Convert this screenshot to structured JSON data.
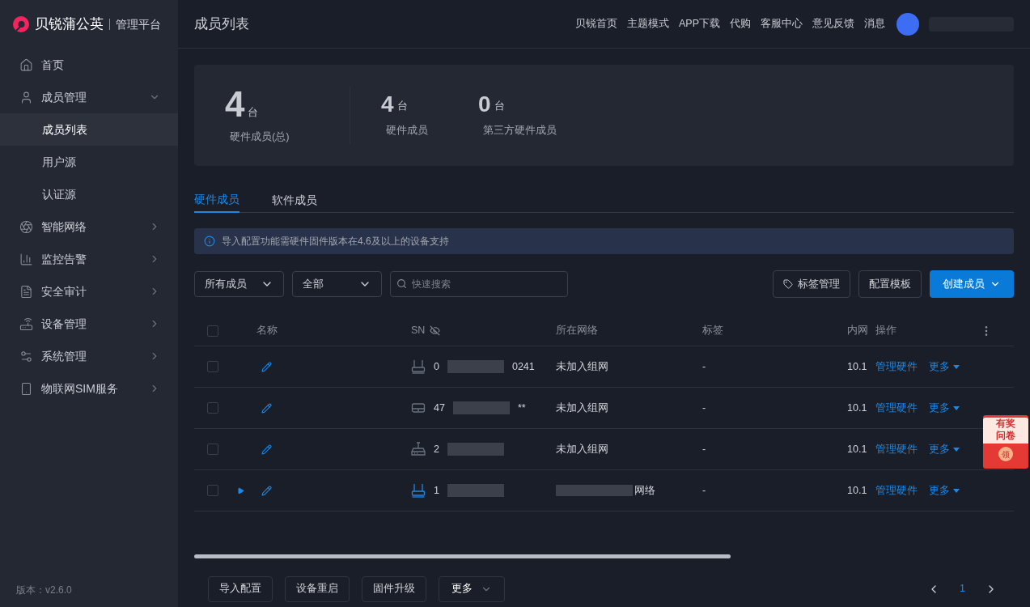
{
  "brand": {
    "name": "贝锐蒲公英",
    "suffix": "管理平台"
  },
  "sidebar": {
    "items": [
      {
        "label": "首页",
        "expanded": false,
        "selected": false
      },
      {
        "label": "成员管理",
        "expanded": true,
        "selected": false,
        "children": [
          {
            "label": "成员列表",
            "selected": true
          },
          {
            "label": "用户源",
            "selected": false
          },
          {
            "label": "认证源",
            "selected": false
          }
        ]
      },
      {
        "label": "智能网络",
        "expanded": false,
        "selected": false
      },
      {
        "label": "监控告警",
        "expanded": false,
        "selected": false
      },
      {
        "label": "安全审计",
        "expanded": false,
        "selected": false
      },
      {
        "label": "设备管理",
        "expanded": false,
        "selected": false
      },
      {
        "label": "系统管理",
        "expanded": false,
        "selected": false
      },
      {
        "label": "物联网SIM服务",
        "expanded": false,
        "selected": false
      }
    ],
    "version": "版本：v2.6.0"
  },
  "header": {
    "title": "成员列表",
    "links": [
      "贝锐首页",
      "主题模式",
      "APP下载",
      "代购",
      "客服中心",
      "意见反馈",
      "消息"
    ]
  },
  "stats": [
    {
      "value": "4",
      "unit": "台",
      "label": "硬件成员(总)"
    },
    {
      "value": "4",
      "unit": "台",
      "label": "硬件成员"
    },
    {
      "value": "0",
      "unit": "台",
      "label": "第三方硬件成员"
    }
  ],
  "tabs": [
    {
      "label": "硬件成员",
      "selected": true
    },
    {
      "label": "软件成员",
      "selected": false
    }
  ],
  "notice": "导入配置功能需硬件固件版本在4.6及以上的设备支持",
  "filters": {
    "selects": [
      "所有成员",
      "全部"
    ],
    "search": {
      "placeholder": "快速搜索"
    }
  },
  "actions": [
    {
      "label": "标签管理",
      "kind": "tag"
    },
    {
      "label": "配置模板",
      "kind": "plain"
    },
    {
      "label": "创建成员",
      "kind": "primary"
    }
  ],
  "table": {
    "header_checked": false,
    "columns": [
      "名称",
      "SN",
      "所在网络",
      "标签",
      "内网",
      "操作"
    ],
    "rows": [
      {
        "kind": "router",
        "expandable": false,
        "highlighted": false,
        "checked": false,
        "sn_head": "0",
        "sn_tail": "0241",
        "network": "未加入组网",
        "network_redacted": false,
        "tag": "-",
        "ip": "10.1",
        "manage": "管理硬件",
        "more": "更多"
      },
      {
        "kind": "box",
        "expandable": false,
        "highlighted": false,
        "checked": false,
        "sn_head": "47",
        "sn_tail": "**",
        "network": "未加入组网",
        "network_redacted": false,
        "tag": "-",
        "ip": "10.1",
        "manage": "管理硬件",
        "more": "更多"
      },
      {
        "kind": "gateway",
        "expandable": false,
        "highlighted": false,
        "checked": false,
        "sn_head": "2",
        "network": "未加入组网",
        "network_redacted": false,
        "tag": "-",
        "ip": "10.1",
        "manage": "管理硬件",
        "more": "更多"
      },
      {
        "kind": "router",
        "expandable": true,
        "highlighted": true,
        "checked": false,
        "sn_head": "1",
        "network": "网络",
        "network_redacted": true,
        "tag": "-",
        "ip": "10.1",
        "manage": "管理硬件",
        "more": "更多"
      }
    ]
  },
  "bulk_buttons": [
    {
      "label": "导入配置",
      "kind": "plain"
    },
    {
      "label": "设备重启",
      "kind": "plain"
    },
    {
      "label": "固件升级",
      "kind": "plain"
    },
    {
      "label": "更多",
      "kind": "dropdown"
    }
  ],
  "pagination": {
    "pages": [
      {
        "label": "1",
        "selected": true
      }
    ]
  },
  "promo": {
    "lines": [
      "有奖",
      "问卷"
    ],
    "seal": "领"
  }
}
